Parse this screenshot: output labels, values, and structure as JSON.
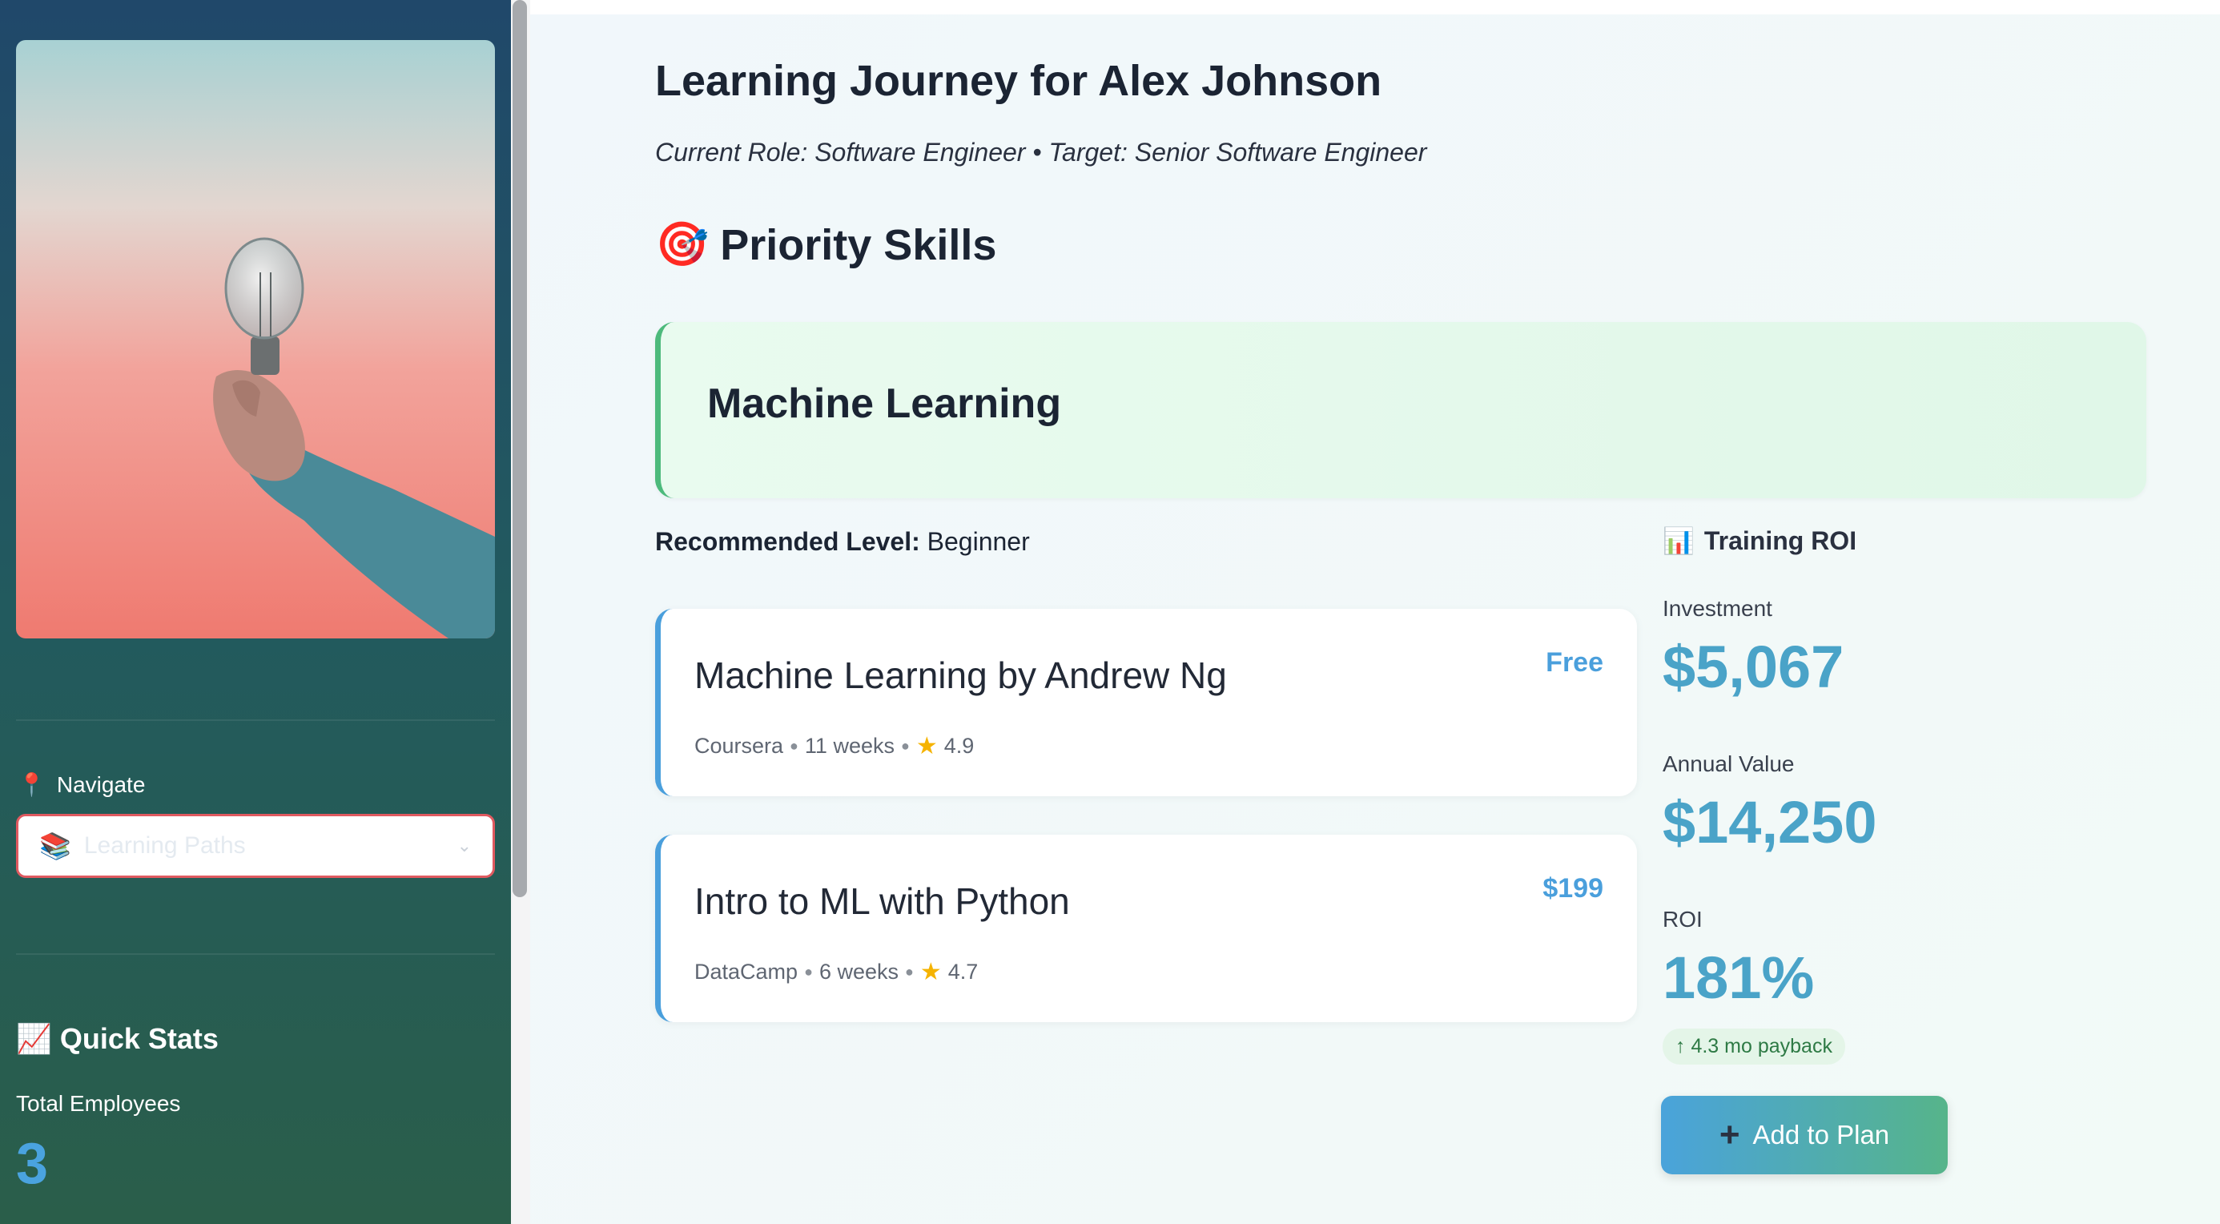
{
  "sidebar": {
    "hero_image": "lightbulb-in-hand-photo",
    "navigate_label": "Navigate",
    "navigate_icon": "pin-icon",
    "nav_select": {
      "icon": "books-icon",
      "value": "Learning Paths"
    },
    "quick_stats": {
      "title": "Quick Stats",
      "icon": "chart-increasing-icon",
      "metric_label": "Total Employees",
      "metric_value": "3"
    }
  },
  "main": {
    "title": "Learning Journey for Alex Johnson",
    "subtitle": "Current Role: Software Engineer • Target: Senior Software Engineer",
    "section_title": "Priority Skills",
    "section_icon": "target-icon",
    "skill": {
      "name": "Machine Learning",
      "recommended_level_label": "Recommended Level:",
      "recommended_level": "Beginner"
    },
    "courses": [
      {
        "title": "Machine Learning by Andrew Ng",
        "price": "Free",
        "provider": "Coursera",
        "duration": "11 weeks",
        "rating": "4.9"
      },
      {
        "title": "Intro to ML with Python",
        "price": "$199",
        "provider": "DataCamp",
        "duration": "6 weeks",
        "rating": "4.7"
      }
    ],
    "roi": {
      "title": "Training ROI",
      "icon": "bar-chart-icon",
      "investment_label": "Investment",
      "investment_value": "$5,067",
      "annual_value_label": "Annual Value",
      "annual_value": "$14,250",
      "roi_label": "ROI",
      "roi_value": "181%",
      "payback": "4.3 mo payback"
    },
    "add_button_label": "Add to Plan"
  },
  "colors": {
    "accent_blue": "#4a9fdc",
    "accent_green": "#4dba7c",
    "select_border": "#e05a60"
  }
}
